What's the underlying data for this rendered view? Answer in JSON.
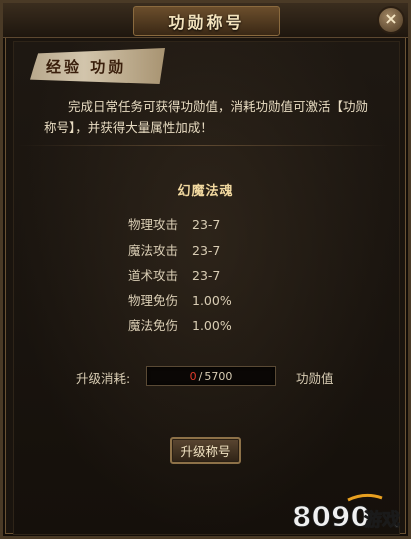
{
  "window": {
    "title": "功勋称号",
    "close_icon": "close-icon"
  },
  "section": {
    "heading": "经验 功勋"
  },
  "description": "完成日常任务可获得功勋值，消耗功勋值可激活【功勋称号】，并获得大量属性加成！",
  "current_title": {
    "name": "幻魔法魂"
  },
  "stats": [
    {
      "label": "物理攻击",
      "value": "23-7"
    },
    {
      "label": "魔法攻击",
      "value": "23-7"
    },
    {
      "label": "道术攻击",
      "value": "23-7"
    },
    {
      "label": "物理免伤",
      "value": "1.00%"
    },
    {
      "label": "魔法免伤",
      "value": "1.00%"
    }
  ],
  "upgrade_cost": {
    "label": "升级消耗:",
    "current": "0",
    "separator": "/",
    "required": "5700",
    "unit": "功勋值"
  },
  "upgrade_button": {
    "label": "升级称号"
  },
  "watermark": {
    "brand": "8090游戏"
  },
  "colors": {
    "accent": "#f2d9a0",
    "cost_current": "#e03a2a",
    "text": "#d9cdb4"
  }
}
